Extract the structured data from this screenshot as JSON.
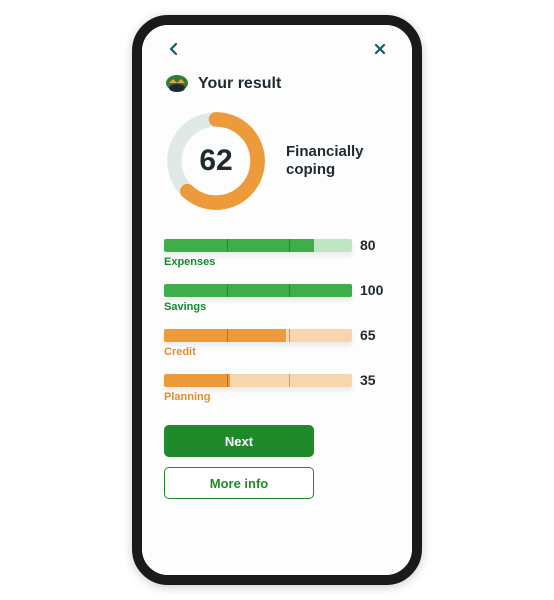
{
  "title": "Your result",
  "score": {
    "value": 62,
    "label": "Financially coping",
    "ring_color": "#ed9a3a",
    "ring_bg": "#dfeae7"
  },
  "bars": [
    {
      "label": "Expenses",
      "value": 80,
      "fill": "#3fae4a",
      "track": "#bfe6c4",
      "caption_class": ""
    },
    {
      "label": "Savings",
      "value": 100,
      "fill": "#3fae4a",
      "track": "#bfe6c4",
      "caption_class": ""
    },
    {
      "label": "Credit",
      "value": 65,
      "fill": "#ed9a3a",
      "track": "#f6d6ad",
      "caption_class": "orange"
    },
    {
      "label": "Planning",
      "value": 35,
      "fill": "#ed9a3a",
      "track": "#f6d6ad",
      "caption_class": "orange"
    }
  ],
  "buttons": {
    "primary": "Next",
    "secondary": "More info"
  },
  "colors": {
    "teal": "#0d5f66",
    "text": "#1e2a30",
    "green": "#1f8a2a"
  },
  "chart_data": {
    "type": "bar",
    "title": "Your result",
    "overall_score": 62,
    "overall_label": "Financially coping",
    "categories": [
      "Expenses",
      "Savings",
      "Credit",
      "Planning"
    ],
    "values": [
      80,
      100,
      65,
      35
    ],
    "ylim": [
      0,
      100
    ]
  }
}
